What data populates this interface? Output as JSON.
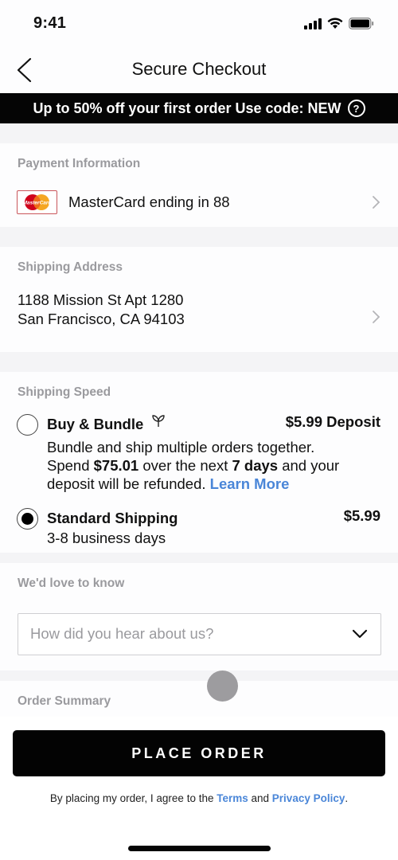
{
  "status_bar": {
    "time": "9:41",
    "icons": [
      "signal-icon",
      "wifi-icon",
      "battery-icon"
    ]
  },
  "nav": {
    "back_icon": "chevron-left-icon",
    "title": "Secure Checkout"
  },
  "promo": {
    "text": "Up to 50% off your first order Use code: NEW",
    "help_icon": "?"
  },
  "payment": {
    "label": "Payment Information",
    "card_brand": "MasterCard",
    "card_text": "MasterCard ending in 88"
  },
  "shipping_address": {
    "label": "Shipping Address",
    "line1": "1188 Mission St Apt 1280",
    "line2": "San Francisco, CA 94103"
  },
  "shipping_speed": {
    "label": "Shipping Speed",
    "options": [
      {
        "title": "Buy & Bundle",
        "icon": "leaf-icon",
        "price": "$5.99 Deposit",
        "selected": false,
        "desc_line1": "Bundle and ship multiple orders together.",
        "desc_spend_pre": "Spend ",
        "desc_spend_amount": "$75.01",
        "desc_spend_mid": " over the next ",
        "desc_spend_days": "7 days",
        "desc_spend_post": " and your",
        "desc_line3": "deposit will be refunded. ",
        "learn_more": "Learn More"
      },
      {
        "title": "Standard Shipping",
        "price": "$5.99",
        "selected": true,
        "desc": "3-8 business days"
      }
    ]
  },
  "survey": {
    "label": "We'd love to know",
    "placeholder": "How did you hear about us?"
  },
  "order_summary": {
    "label": "Order Summary"
  },
  "place_order": {
    "label": "PLACE ORDER"
  },
  "legal": {
    "pre": "By placing my order, I agree to the ",
    "terms": "Terms",
    "mid": " and ",
    "privacy": "Privacy Policy",
    "post": "."
  },
  "colors": {
    "link": "#4a86d8",
    "primary_button": "#030303",
    "section_label": "#9a9a9e",
    "promo_bg": "#050505"
  }
}
